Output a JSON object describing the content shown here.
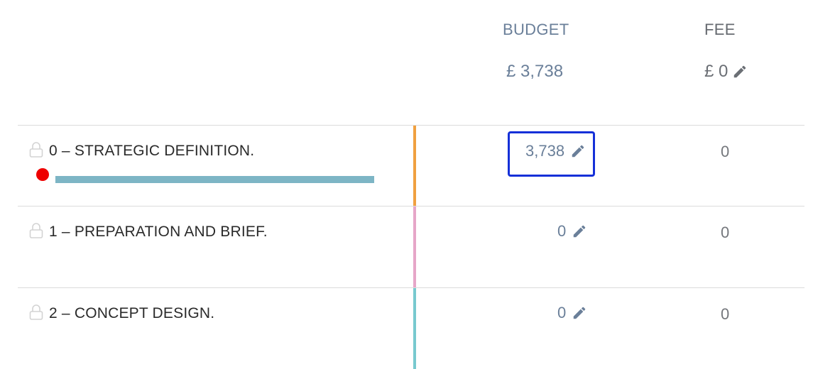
{
  "header": {
    "budget_label": "BUDGET",
    "fee_label": "FEE",
    "budget_total": "£ 3,738",
    "fee_total": "£ 0"
  },
  "colors": {
    "stage0_bar": "#f0a040",
    "stage1_bar": "#e6a6c8",
    "stage2_bar": "#78c9cf",
    "progress": "#7db5c5",
    "selection_border": "#1530d8",
    "alert_dot": "#ee0000"
  },
  "rows": [
    {
      "label": "0 – STRATEGIC DEFINITION.",
      "budget": "3,738",
      "fee": "0",
      "progress_fraction": 1.0
    },
    {
      "label": "1 – PREPARATION AND BRIEF.",
      "budget": "0",
      "fee": "0"
    },
    {
      "label": "2 – CONCEPT DESIGN.",
      "budget": "0",
      "fee": "0"
    }
  ],
  "icons": {
    "lock": "lock-icon",
    "edit": "pencil-icon"
  }
}
